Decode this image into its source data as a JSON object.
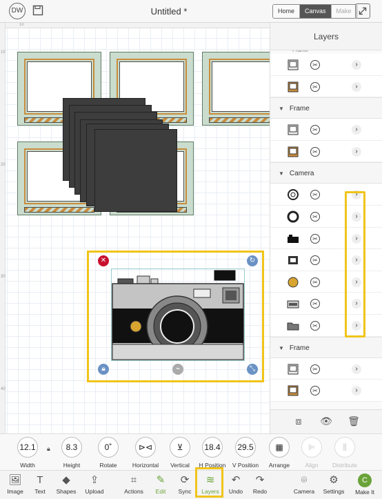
{
  "header": {
    "avatar_initials": "DW",
    "title": "Untitled *",
    "tabs": [
      "Home",
      "Canvas",
      "Make"
    ],
    "active_tab": "Canvas"
  },
  "ruler": {
    "top_marks": [
      "10"
    ],
    "left_marks": [
      "10",
      "20",
      "30",
      "40"
    ]
  },
  "layers_panel": {
    "title": "Layers",
    "groups": [
      {
        "name": "Frame",
        "rows": [
          "frame-outline",
          "frame-orange"
        ]
      },
      {
        "name": "Frame",
        "rows": [
          "frame-outline",
          "frame-orange"
        ]
      },
      {
        "name": "Camera",
        "rows": [
          "lens-ring",
          "ring",
          "camera-silhouette",
          "square-frame",
          "gold-circle",
          "camera-body",
          "folder-shape"
        ]
      },
      {
        "name": "Frame",
        "rows": [
          "frame-outline",
          "frame-orange"
        ]
      }
    ],
    "partial_group_label": "Frame"
  },
  "properties": [
    {
      "value": "12.1",
      "label": "Width"
    },
    {
      "value": "8.3",
      "label": "Height"
    },
    {
      "value": "0˚",
      "label": "Rotate"
    },
    {
      "value": "⊳⊲",
      "label": "Horizontal"
    },
    {
      "value": "⊻",
      "label": "Vertical"
    },
    {
      "value": "18.4",
      "label": "H Position"
    },
    {
      "value": "29.5",
      "label": "V Position"
    },
    {
      "value": "▦",
      "label": "Arrange"
    },
    {
      "value": "⊫",
      "label": "Align"
    },
    {
      "value": "⫼",
      "label": "Distribute"
    }
  ],
  "toolbar": [
    {
      "label": "Image",
      "icon": "image-icon"
    },
    {
      "label": "Text",
      "icon": "text-icon"
    },
    {
      "label": "Shapes",
      "icon": "shapes-icon"
    },
    {
      "label": "Upload",
      "icon": "upload-icon"
    },
    {
      "label": "Actions",
      "icon": "actions-icon"
    },
    {
      "label": "Edit",
      "icon": "edit-icon"
    },
    {
      "label": "Sync",
      "icon": "sync-icon"
    },
    {
      "label": "Layers",
      "icon": "layers-icon"
    },
    {
      "label": "Undo",
      "icon": "undo-icon"
    },
    {
      "label": "Redo",
      "icon": "redo-icon"
    },
    {
      "label": "Camera",
      "icon": "camera-icon"
    },
    {
      "label": "Settings",
      "icon": "settings-icon"
    },
    {
      "label": "Make It",
      "icon": "make-it-icon"
    }
  ],
  "colors": {
    "highlight": "#f0c419",
    "accent_green": "#6aa339",
    "frame_fill": "#c9dccd",
    "frame_orange": "#c98c3c"
  }
}
